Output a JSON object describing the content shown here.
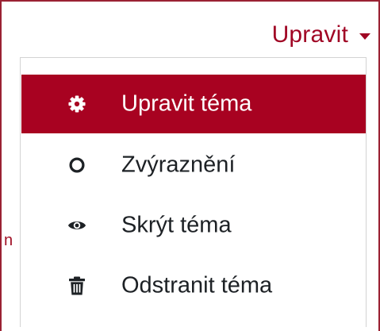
{
  "trigger": {
    "label": "Upravit",
    "icon": "caret-down-icon"
  },
  "background_fragment": "n",
  "menu": {
    "items": [
      {
        "label": "Upravit téma",
        "icon": "gear-icon",
        "active": true
      },
      {
        "label": "Zvýraznění",
        "icon": "circle-outline-icon",
        "active": false
      },
      {
        "label": "Skrýt téma",
        "icon": "eye-icon",
        "active": false
      },
      {
        "label": "Odstranit téma",
        "icon": "trash-icon",
        "active": false
      }
    ]
  },
  "colors": {
    "accent": "#a80221",
    "text": "#1d2125",
    "active_text": "#ffffff",
    "border": "#9a2233"
  }
}
